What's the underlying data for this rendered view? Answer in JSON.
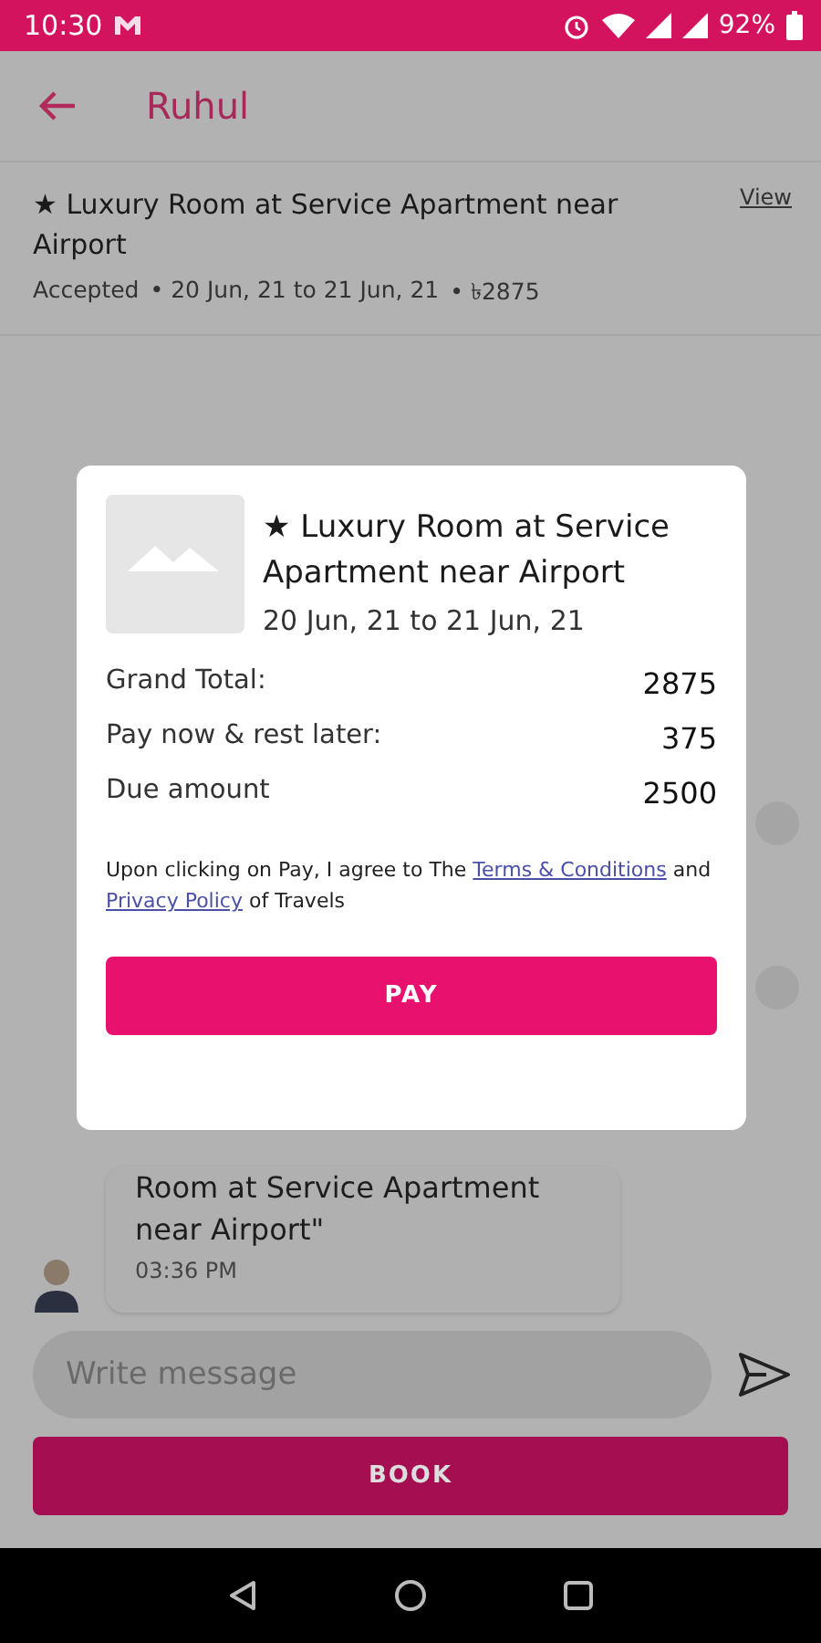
{
  "status_bar": {
    "time": "10:30",
    "battery": "92%"
  },
  "header": {
    "title": "Ruhul"
  },
  "booking": {
    "title": "★ Luxury Room at Service Apartment near Airport",
    "status": "Accepted",
    "dates": "• 20 Jun, 21 to 21 Jun, 21",
    "price": "• ৳2875",
    "view_link": "View"
  },
  "message": {
    "text": "Room at Service Apartment near Airport\"",
    "time": "03:36 PM"
  },
  "composer": {
    "placeholder": "Write message"
  },
  "book_button": "BOOK",
  "dialog": {
    "title": "★ Luxury Room at Service Apartment near Airport",
    "dates": "20 Jun, 21 to 21 Jun, 21",
    "rows": [
      {
        "label": "Grand Total:",
        "value": "2875"
      },
      {
        "label": "Pay now & rest later:",
        "value": "375"
      },
      {
        "label": "Due amount",
        "value": "2500"
      }
    ],
    "terms": {
      "before": "Upon clicking on Pay, I agree to The ",
      "terms_link": "Terms & Conditions",
      "middle": " and ",
      "privacy_link": "Privacy Policy",
      "after": " of Travels"
    },
    "pay_button": "PAY"
  }
}
